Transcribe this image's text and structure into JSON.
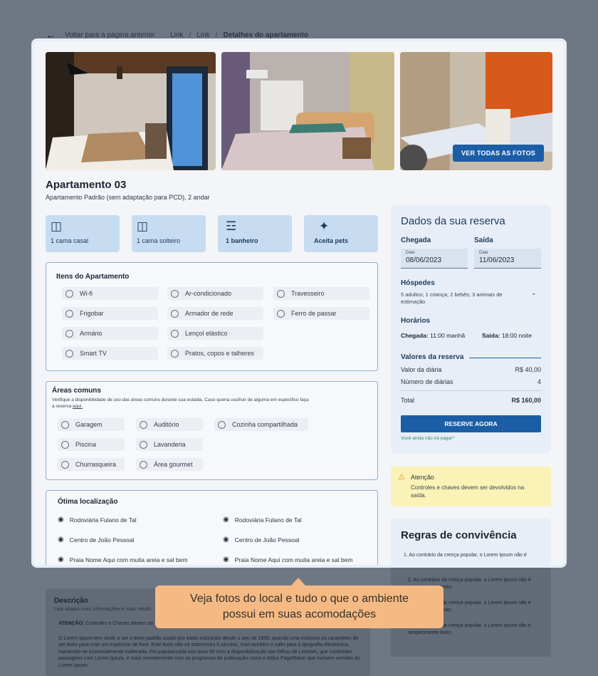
{
  "breadcrumb": {
    "back_label": "Voltar para a página anterior",
    "link1": "Link",
    "link2": "Link",
    "separator": "/",
    "current": "Detalhes do apartamento"
  },
  "gallery": {
    "view_all_label": "VER TODAS AS FOTOS"
  },
  "apartment": {
    "title": "Apartamento 03",
    "subtitle": "Apartamento Padrão (sem adaptação para PCD), 2 andar"
  },
  "features": [
    {
      "icon": "bed-icon",
      "label": "1 cama casal"
    },
    {
      "icon": "single-bed-icon",
      "label": "1  cama solteiro"
    },
    {
      "icon": "bathtub-icon",
      "label": "1 banheiro"
    },
    {
      "icon": "paw-icon",
      "label": "Aceita pets"
    }
  ],
  "amenities": {
    "title": "Itens do Apartamento",
    "items": [
      "Wi-fi",
      "Ar-condicionado",
      "Travesseiro",
      "Frigobar",
      "Armador de rede",
      "Ferro de passar",
      "Armário",
      "Lençol elástico",
      "Smart TV",
      "Pratos, copos e talheres"
    ]
  },
  "common_areas": {
    "title": "Áreas comuns",
    "description_1": "Verifique a disponibilidade de uso das áreas comuns durante sua estadia. Caso queria usufruir de alguma em especifico faça",
    "description_2": "a reserva ",
    "description_link": "aqui.",
    "items": [
      "Garagem",
      "Auditório",
      "Cozinha compartilhada",
      "Piscina",
      "Lavanderia",
      "Churrasqueira",
      "Área gourmet"
    ]
  },
  "location": {
    "title": "Ótima localização",
    "items": [
      "Rodoviária Fulano de Tal",
      "Rodoviária Fulano de Tal",
      "Centro de João Pessoal",
      "Centro de João Pessoal",
      "Praia Nome Aqui com muita areia e sal bem",
      "Praia Nome Aqui com muita areia e sal bem"
    ]
  },
  "description": {
    "title": "Descrição",
    "subtitle": "Leia abaixo mais informações e mais detalh",
    "attention_label": "ATENÇÃO:",
    "attention_text": " Controles e Chaves devem ser d",
    "body": "O Lorem Ipsum tem vindo a ser o texto padrão usado por estas indústrias desde o ano de 1500, quando uma misturou os caracteres de um texto para criar um espécime de livro. Este texto não só sobreviveu 5 séculos, mas também o salto para a tipografia electrónica, mantendo-se essencialmente inalterada. Foi popularizada nos anos 60 com a disponibilização das folhas de Letraset, que continham passagens com Lorem Ipsum, e mais recentemente com os programas de publicação como o Aldus PageMaker que incluem versões do Lorem Ipsum."
  },
  "reservation": {
    "title": "Dados da sua reserva",
    "checkin_label": "Chegada",
    "checkout_label": "Saída",
    "date_caption": "Date",
    "checkin_date": "08/06/2023",
    "checkout_date": "11/06/2023",
    "guests_label": "Hóspedes",
    "guests_value": "5 adultos; 1 criança; 2 bebês; 3 animais de estimação",
    "hours_label": "Horários",
    "checkin_time_label": "Chegada:",
    "checkin_time": " 11:00 manhã",
    "checkout_time_label": "Saída:",
    "checkout_time": " 18:00 noite",
    "values_label": "Valores da reserva",
    "daily_label": "Valor da diária",
    "daily_value": "R$ 40,00",
    "nights_label": "Número de diárias",
    "nights_value": "4",
    "total_label": "Total",
    "total_value": "R$ 160,00",
    "button_label": "RESERVE AGORA",
    "note": "Você ainda não irá pagar*"
  },
  "attention": {
    "title": "Atenção",
    "text": "Controles e chaves devem ser devolvidos na saída."
  },
  "rules": {
    "title": "Regras de convivência",
    "items": [
      "1. Ao contrário da crença popular, o Lorem Ipsum não é",
      "2. Ao contrário da crença popular, o Lorem Ipsum não é simplesmente texto;",
      "3. Ao contrário da crença popular, o Lorem Ipsum não é simplesmente texto;",
      "4. Ao contrário da crença popular, o Lorem Ipsum não é simplesmente texto;"
    ]
  },
  "tooltip": {
    "text": "Veja fotos do local e tudo o que o ambiente possui em suas acomodações"
  },
  "colors": {
    "accent": "#1b5ea6",
    "card_bg": "#c7dcf0",
    "tooltip_bg": "#f5ba84",
    "attention_bg": "#fbf2b7"
  }
}
